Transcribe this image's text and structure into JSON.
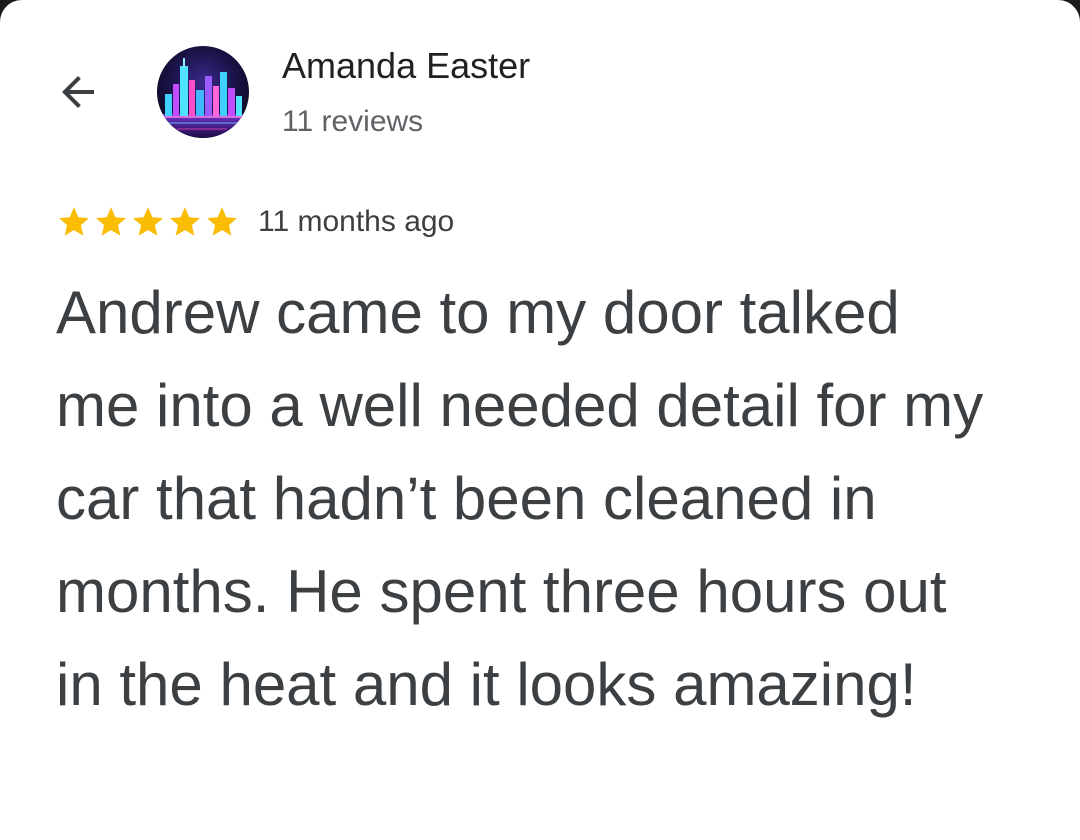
{
  "header": {
    "back_icon": "arrow-left-icon",
    "reviewer": {
      "name": "Amanda Easter",
      "review_count": "11 reviews",
      "avatar_icon": "city-skyline-avatar"
    }
  },
  "review": {
    "rating": 5,
    "rating_max": 5,
    "star_color": "#fbbc04",
    "time": "11 months ago",
    "text": "Andrew came to my door talked me into a well needed detail for my car that hadn’t been cleaned in months. He spent three hours out in the heat and it looks amazing!"
  },
  "colors": {
    "background": "#ffffff",
    "primary_text": "#202124",
    "secondary_text": "#5f6368",
    "body_text": "#3c4043"
  }
}
